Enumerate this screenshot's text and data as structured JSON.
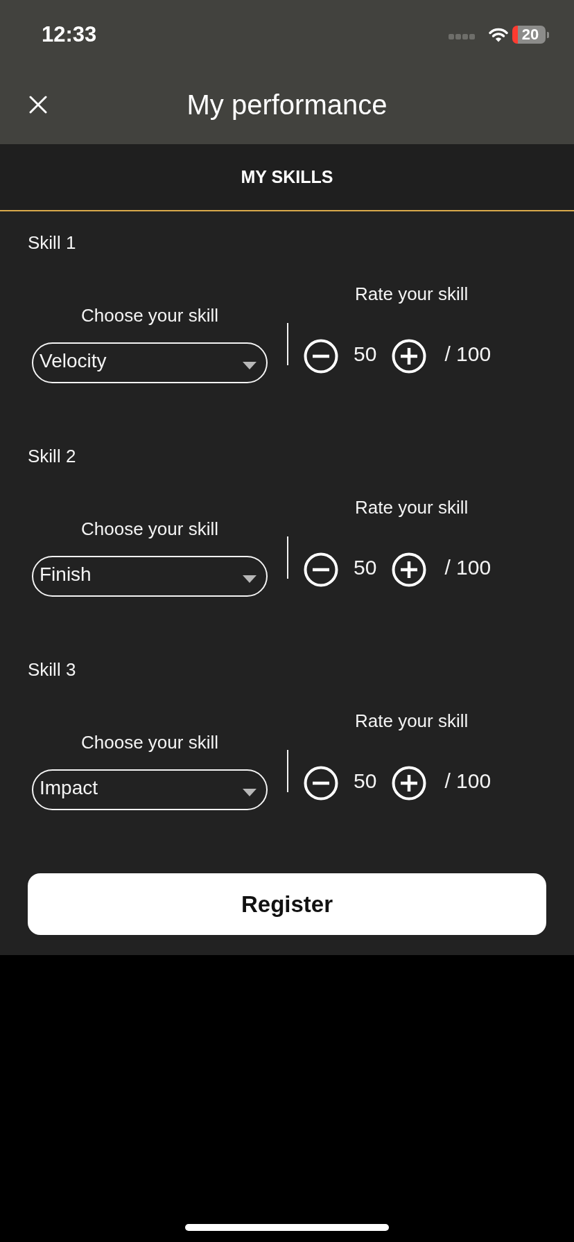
{
  "status_bar": {
    "time": "12:33",
    "battery": "20"
  },
  "header": {
    "title": "My performance"
  },
  "tabs": [
    {
      "label": "MY SKILLS",
      "selected": true
    }
  ],
  "skills": [
    {
      "label": "Skill 1",
      "choose_label": "Choose your skill",
      "selection": "Velocity",
      "rate_label": "Rate your skill",
      "rating": "50",
      "rating_max": "/ 100"
    },
    {
      "label": "Skill 2",
      "choose_label": "Choose your skill",
      "selection": "Finish",
      "rate_label": "Rate your skill",
      "rating": "50",
      "rating_max": "/ 100"
    },
    {
      "label": "Skill 3",
      "choose_label": "Choose your skill",
      "selection": "Impact",
      "rate_label": "Rate your skill",
      "rating": "50",
      "rating_max": "/ 100"
    }
  ],
  "register_button": {
    "label": "Register"
  }
}
